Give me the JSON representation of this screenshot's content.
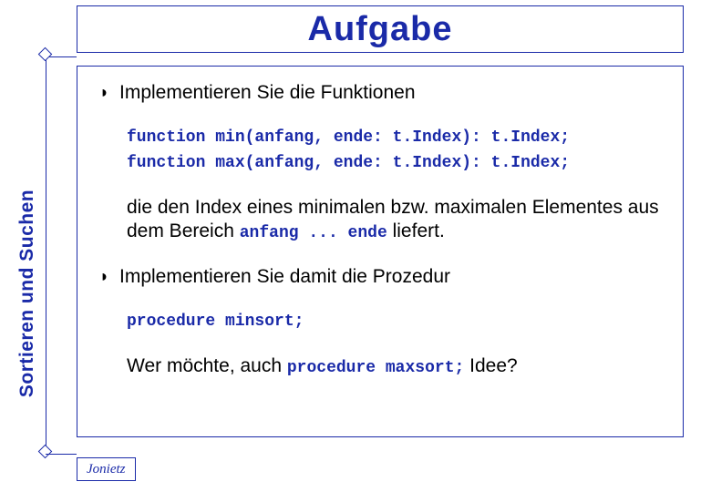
{
  "title": "Aufgabe",
  "sidebar_label": "Sortieren und Suchen",
  "item1": {
    "text": "Implementieren Sie die Funktionen",
    "code_line1": "function min(anfang, ende: t.Index): t.Index;",
    "code_line2": "function max(anfang, ende: t.Index): t.Index;",
    "para_a": "die den Index eines minimalen bzw. maximalen Elementes aus dem Bereich ",
    "para_b_code": "anfang ... ende",
    "para_c": "  liefert."
  },
  "item2": {
    "text": "Implementieren Sie damit die Prozedur",
    "code_line1": "procedure minsort;",
    "para_a": "Wer möchte, auch ",
    "para_b_code": "procedure maxsort;",
    "para_c": " Idee?"
  },
  "footer": "Jonietz"
}
